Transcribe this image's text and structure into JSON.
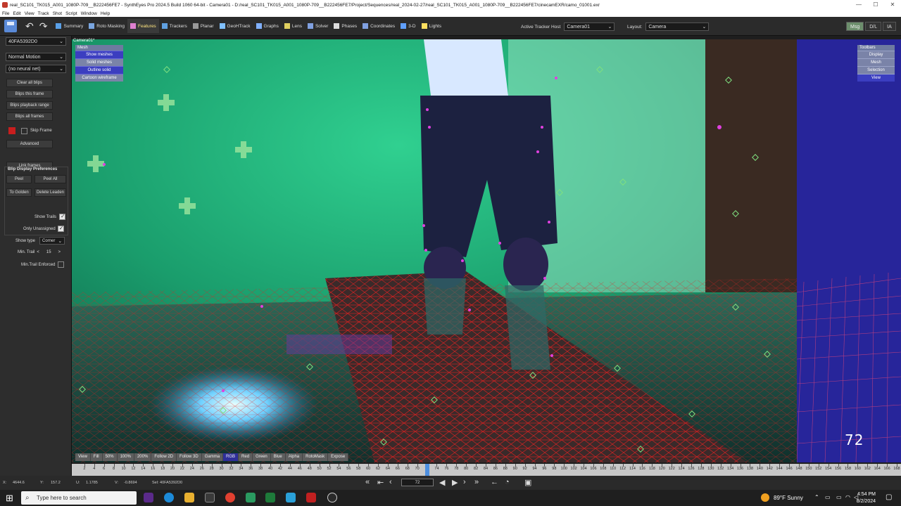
{
  "titlebar": {
    "title": "real_SC101_TK015_A001_1080P-709__B222456FE7 - SynthEyes Pro 2024.5 Build 1060 64-bit - Camera01 - D:/real_SC101_TK015_A001_1080P-709__B222456FE7/Project/Sequences/real_2024-02-27/real_SC101_TK015_A001_1080P-709__B222456FE7/cinecamEXR/camo_01001.exr",
    "min": "—",
    "max": "☐",
    "close": "✕"
  },
  "menu": [
    "File",
    "Edit",
    "View",
    "Track",
    "Shot",
    "Script",
    "Window",
    "Help"
  ],
  "toolbar": {
    "items": [
      {
        "label": "Summary",
        "color": "#5aa0e8"
      },
      {
        "label": "Roto Masking",
        "color": "#7aa6e0"
      },
      {
        "label": "Features",
        "color": "#e080d0"
      },
      {
        "label": "Trackers",
        "color": "#60a0e0"
      },
      {
        "label": "Planar",
        "color": "#999999"
      },
      {
        "label": "GeoHTrack",
        "color": "#80c0ff"
      },
      {
        "label": "Graphs",
        "color": "#80b0ff"
      },
      {
        "label": "Lens",
        "color": "#e0d060"
      },
      {
        "label": "Solver",
        "color": "#80a0e0"
      },
      {
        "label": "Phases",
        "color": "#dddddd"
      },
      {
        "label": "Coordinates",
        "color": "#80a0e0"
      },
      {
        "label": "3-D",
        "color": "#60a0ff"
      },
      {
        "label": "Lights",
        "color": "#ffe060"
      }
    ],
    "active_tracker_label": "Active Tracker Host",
    "active_tracker_value": "Camera01",
    "layout_label": "Layout:",
    "layout_value": "Camera",
    "right_buttons": [
      "Msg",
      "D/L",
      "IA"
    ]
  },
  "left_panel": {
    "object_select": "40FA5392D0",
    "motion_select": "Normal Motion",
    "neural_select": "(no neural net)",
    "buttons": {
      "clear_all": "Clear all blips",
      "blips_frame": "Blips this frame",
      "blips_range": "Blips playback range",
      "blips_all": "Blips all frames",
      "advanced": "Advanced",
      "link_frames": "Link frames",
      "peel": "Peel",
      "peel_all": "Peel All",
      "to_golden": "To Golden",
      "delete_leaden": "Delete Leaden"
    },
    "skip_frame": "Skip Frame",
    "prefs": {
      "title": "Blip Display Preferences",
      "show_trails": "Show Trails",
      "only_unassigned": "Only Unassigned",
      "show_type_label": "Show type",
      "show_type_value": "Corner",
      "min_trail_label": "Min. Trail",
      "min_trail_value": "15",
      "min_trail_enforced": "Min.Trail Enforced"
    }
  },
  "viewport": {
    "camera_label": "Camera01*",
    "mesh_menu": {
      "header": "Mesh",
      "items": [
        "Show meshes",
        "Solid meshes",
        "Outline solid",
        "Cartoon wireframe"
      ]
    },
    "toolbars_menu": {
      "header": "Toolbars",
      "items": [
        "Display",
        "Mesh",
        "Selection",
        "View"
      ]
    },
    "frame_number": "72",
    "viewbar": [
      "View",
      "Fill",
      "50%",
      "100%",
      "200%",
      "Follow 2D",
      "Follow 3D",
      "Gamma",
      "RGB",
      "Red",
      "Green",
      "Blue",
      "Alpha",
      "RotoMask",
      "Expose"
    ]
  },
  "timeline": {
    "current_frame": 72,
    "start": 0,
    "end": 168,
    "labels": [
      "2",
      "4",
      "6",
      "8",
      "10",
      "12",
      "14",
      "16",
      "18",
      "20",
      "22",
      "24",
      "26",
      "28",
      "30",
      "32",
      "34",
      "36",
      "38",
      "40",
      "42",
      "44",
      "46",
      "48",
      "50",
      "52",
      "54",
      "56",
      "58",
      "60",
      "62",
      "64",
      "66",
      "68",
      "70",
      "72",
      "74",
      "76",
      "78",
      "80",
      "82",
      "84",
      "86",
      "88",
      "90",
      "92",
      "94",
      "96",
      "98",
      "100",
      "102",
      "104",
      "106",
      "108",
      "110",
      "112",
      "114",
      "116",
      "118",
      "120",
      "122",
      "124",
      "126",
      "128",
      "130",
      "132",
      "134",
      "136",
      "138",
      "140",
      "142",
      "144",
      "146",
      "148",
      "150",
      "152",
      "154",
      "156",
      "158",
      "160",
      "162",
      "164",
      "166",
      "168"
    ]
  },
  "status": {
    "x_label": "X:",
    "x_value": "4644.6",
    "y_label": "Y:",
    "y_value": "157.2",
    "u_label": "U:",
    "u_value": "1.1785",
    "v_label": "V:",
    "v_value": "-0.8694",
    "sel": "Sel: 40FA5392D0",
    "frame_field": "72"
  },
  "taskbar": {
    "search_placeholder": "Type here to search",
    "weather": "89°F  Sunny",
    "time": "4:54 PM",
    "date": "8/2/2024"
  }
}
